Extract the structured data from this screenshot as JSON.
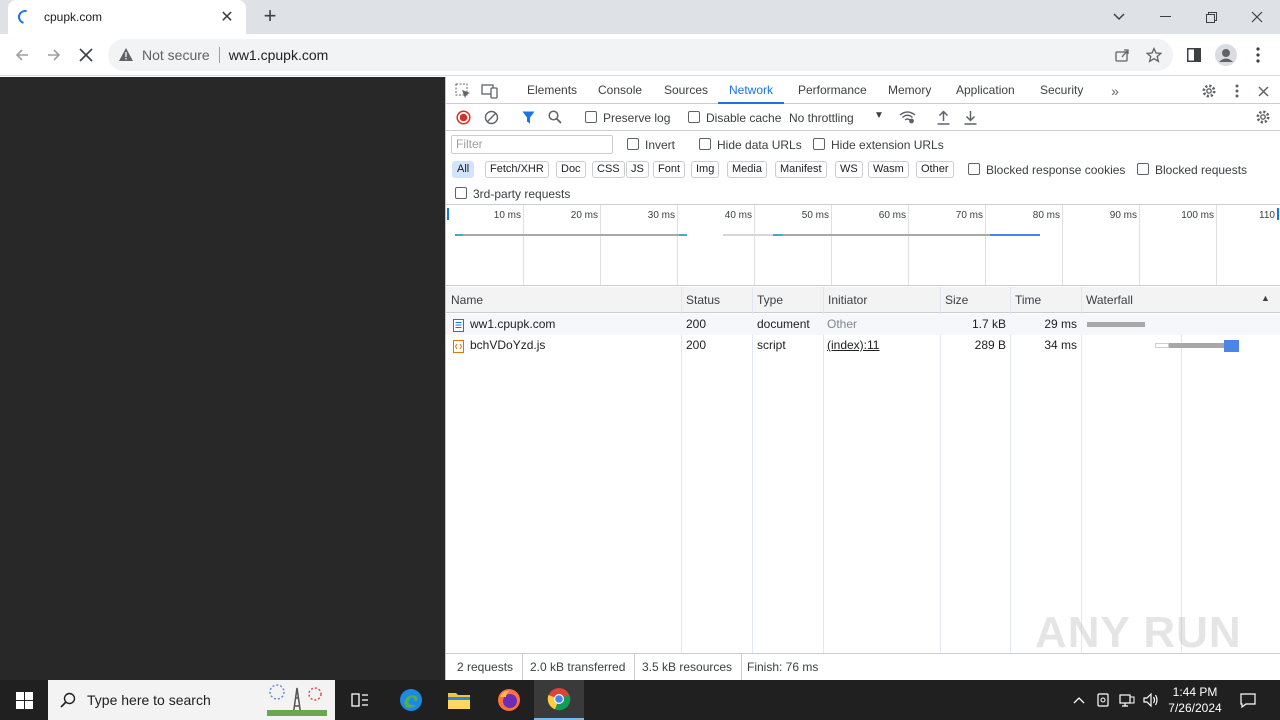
{
  "browser": {
    "tab_title": "cpupk.com",
    "omnibox": {
      "security_label": "Not secure",
      "url": "ww1.cpupk.com"
    }
  },
  "devtools": {
    "tabs": [
      "Elements",
      "Console",
      "Sources",
      "Network",
      "Performance",
      "Memory",
      "Application",
      "Security"
    ],
    "active_tab": "Network",
    "toolbar": {
      "preserve_log": "Preserve log",
      "disable_cache": "Disable cache",
      "throttling": "No throttling"
    },
    "filter": {
      "placeholder": "Filter",
      "invert": "Invert",
      "hide_data_urls": "Hide data URLs",
      "hide_extension_urls": "Hide extension URLs",
      "types": [
        "All",
        "Fetch/XHR",
        "Doc",
        "CSS",
        "JS",
        "Font",
        "Img",
        "Media",
        "Manifest",
        "WS",
        "Wasm",
        "Other"
      ],
      "active_type": "All",
      "blocked_response_cookies": "Blocked response cookies",
      "blocked_requests": "Blocked requests",
      "third_party": "3rd-party requests"
    },
    "overview_ticks": [
      "10 ms",
      "20 ms",
      "30 ms",
      "40 ms",
      "50 ms",
      "60 ms",
      "70 ms",
      "80 ms",
      "90 ms",
      "100 ms",
      "110"
    ],
    "columns": [
      "Name",
      "Status",
      "Type",
      "Initiator",
      "Size",
      "Time",
      "Waterfall"
    ],
    "requests": [
      {
        "name": "ww1.cpupk.com",
        "status": "200",
        "type": "document",
        "initiator": "Other",
        "size": "1.7 kB",
        "time": "29 ms",
        "icon": "document-icon"
      },
      {
        "name": "bchVDoYzd.js",
        "status": "200",
        "type": "script",
        "initiator": "(index):11",
        "size": "289 B",
        "time": "34 ms",
        "icon": "script-icon"
      }
    ],
    "status_bar": {
      "requests": "2 requests",
      "transferred": "2.0 kB transferred",
      "resources": "3.5 kB resources",
      "finish": "Finish: 76 ms"
    }
  },
  "taskbar": {
    "search_placeholder": "Type here to search",
    "time": "1:44 PM",
    "date": "7/26/2024"
  },
  "watermark": "ANY RUN"
}
